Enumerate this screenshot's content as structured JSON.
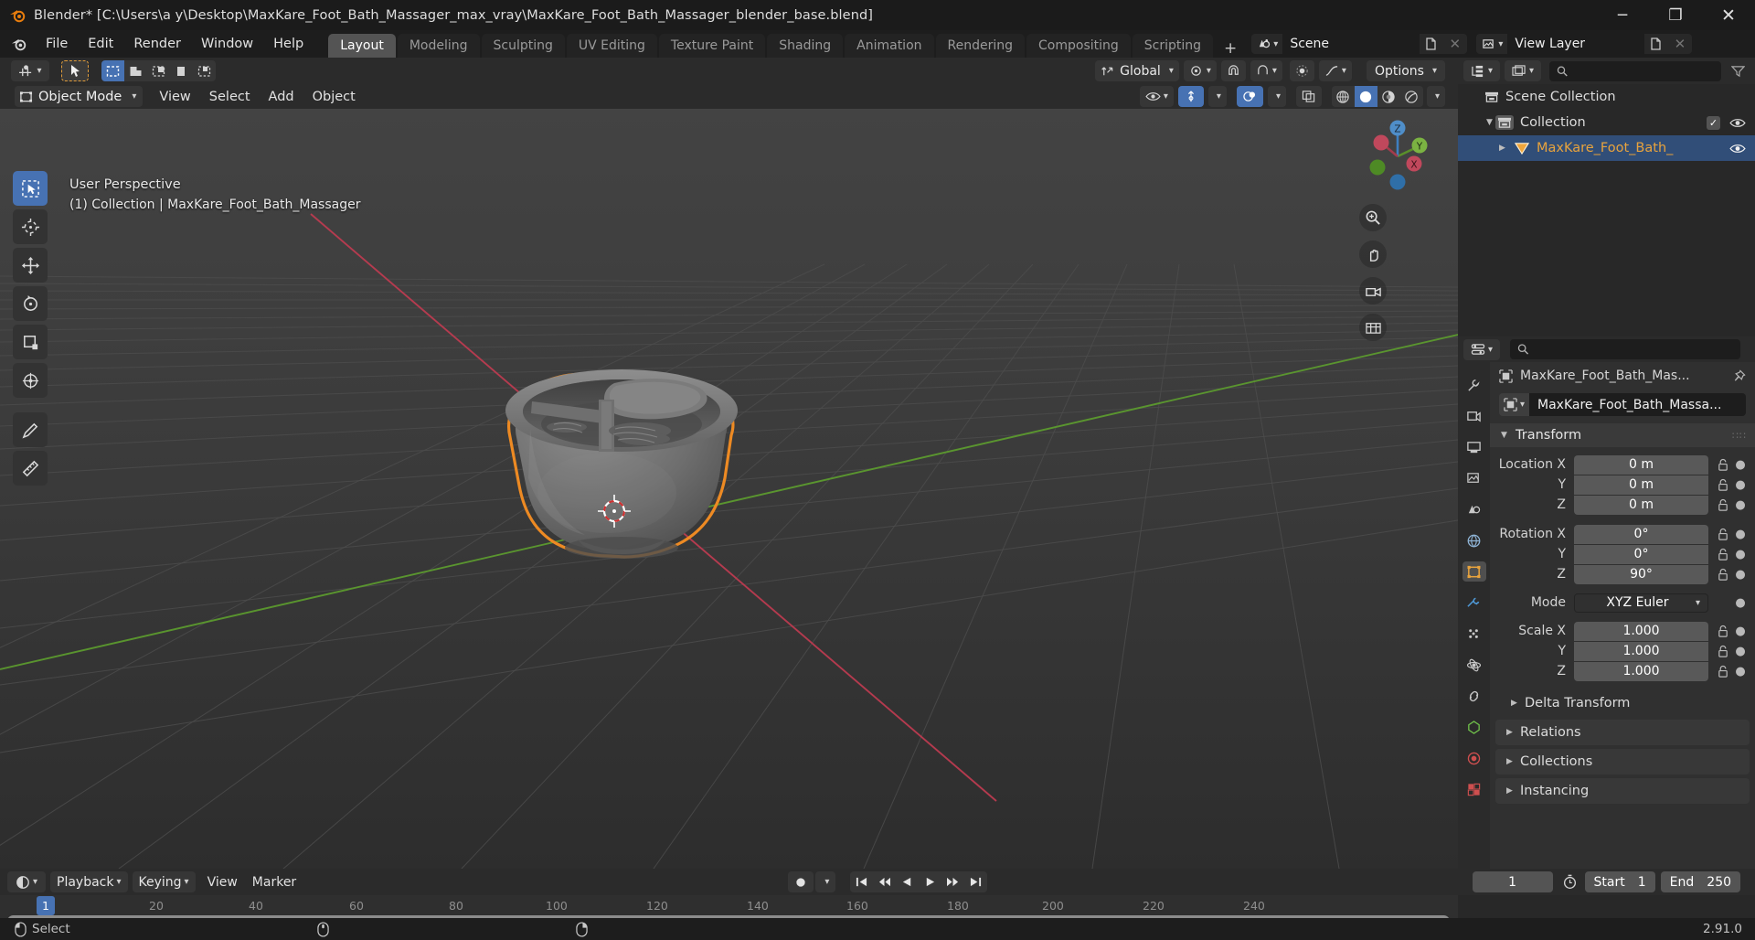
{
  "window": {
    "title": "Blender* [C:\\Users\\a y\\Desktop\\MaxKare_Foot_Bath_Massager_max_vray\\MaxKare_Foot_Bath_Massager_blender_base.blend]",
    "minimize": "─",
    "maximize": "❐",
    "close": "✕"
  },
  "topbar": {
    "menus": [
      "File",
      "Edit",
      "Render",
      "Window",
      "Help"
    ],
    "workspaces": [
      {
        "label": "Layout",
        "active": true
      },
      {
        "label": "Modeling",
        "active": false
      },
      {
        "label": "Sculpting",
        "active": false
      },
      {
        "label": "UV Editing",
        "active": false
      },
      {
        "label": "Texture Paint",
        "active": false
      },
      {
        "label": "Shading",
        "active": false
      },
      {
        "label": "Animation",
        "active": false
      },
      {
        "label": "Rendering",
        "active": false
      },
      {
        "label": "Compositing",
        "active": false
      },
      {
        "label": "Scripting",
        "active": false
      }
    ],
    "add_workspace": "+",
    "scene_name": "Scene",
    "view_layer_name": "View Layer",
    "new_label": "",
    "close_x": "✕"
  },
  "viewport": {
    "header": {
      "transform_orientation": "Global",
      "options_label": "Options"
    },
    "header2": {
      "mode": "Object Mode",
      "menus": [
        "View",
        "Select",
        "Add",
        "Object"
      ]
    },
    "overlay": {
      "perspective": "User Perspective",
      "context": "(1) Collection | MaxKare_Foot_Bath_Massager"
    },
    "gizmo_axes": {
      "x": "X",
      "y": "Y",
      "z": "Z"
    }
  },
  "outliner": {
    "search_placeholder": "",
    "rows": [
      {
        "label": "Scene Collection",
        "indent": 0,
        "icon": "collection-icon",
        "selected": false,
        "expand": "",
        "checkbox": false,
        "eye": false
      },
      {
        "label": "Collection",
        "indent": 1,
        "icon": "collection-icon",
        "selected": false,
        "expand": "▼",
        "checkbox": true,
        "eye": true
      },
      {
        "label": "MaxKare_Foot_Bath_",
        "indent": 2,
        "icon": "mesh-object-icon",
        "selected": true,
        "expand": "▶",
        "checkbox": false,
        "eye": true
      }
    ]
  },
  "properties": {
    "search_placeholder": "",
    "breadcrumb": "MaxKare_Foot_Bath_Mas...",
    "object_name": "MaxKare_Foot_Bath_Massa...",
    "transform": {
      "title": "Transform",
      "location": {
        "label_x": "Location X",
        "label_y": "Y",
        "label_z": "Z",
        "x": "0 m",
        "y": "0 m",
        "z": "0 m"
      },
      "rotation": {
        "label_x": "Rotation X",
        "label_y": "Y",
        "label_z": "Z",
        "x": "0°",
        "y": "0°",
        "z": "90°"
      },
      "mode": {
        "label": "Mode",
        "value": "XYZ Euler"
      },
      "scale": {
        "label_x": "Scale X",
        "label_y": "Y",
        "label_z": "Z",
        "x": "1.000",
        "y": "1.000",
        "z": "1.000"
      }
    },
    "subpanels": [
      {
        "label": "Delta Transform",
        "boxed": false,
        "tri": "▶"
      },
      {
        "label": "Relations",
        "boxed": true,
        "tri": "▶"
      },
      {
        "label": "Collections",
        "boxed": true,
        "tri": "▶"
      },
      {
        "label": "Instancing",
        "boxed": true,
        "tri": "▶"
      }
    ]
  },
  "timeline": {
    "menus": [
      "View",
      "Marker"
    ],
    "playback": "Playback",
    "keying": "Keying",
    "current_frame": "1",
    "start_label": "Start",
    "start_value": "1",
    "end_label": "End",
    "end_value": "250",
    "playhead_label": "1",
    "ticks": [
      "20",
      "40",
      "60",
      "80",
      "100",
      "120",
      "140",
      "160",
      "180",
      "200",
      "220",
      "240"
    ],
    "tick_values": [
      20,
      40,
      60,
      80,
      100,
      120,
      140,
      160,
      180,
      200,
      220,
      240
    ]
  },
  "statusbar": {
    "select_label": "Select",
    "version": "2.91.0"
  },
  "colors": {
    "accent_blue": "#4772b3",
    "selected_orange": "#e8a33d",
    "outline_orange": "#ed8a23",
    "axis_x_red": "#c0384f",
    "axis_y_green": "#5c9a2e",
    "panel_bg": "#303030",
    "header_bg": "#2b2b2b"
  }
}
